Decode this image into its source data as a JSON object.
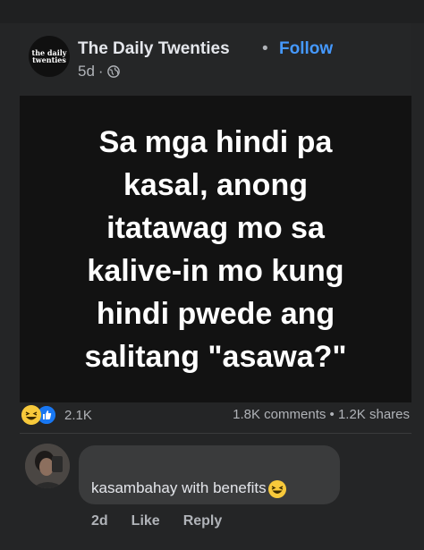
{
  "post": {
    "page_name": "The Daily Twenties",
    "separator": "•",
    "follow_label": "Follow",
    "time": "5d",
    "meta_separator": "·",
    "logo_text_line1": "the daily",
    "logo_text_line2": "twenties",
    "image_text": "Sa mga hindi pa\nkasal, anong\nitatawag mo sa\nkalive-in mo kung\nhindi pwede ang\nsalitang \"asawa?\""
  },
  "stats": {
    "reaction_count": "2.1K",
    "comments_shares": "1.8K comments • 1.2K shares",
    "reaction_icons": [
      "haha-icon",
      "like-icon"
    ]
  },
  "comment": {
    "text": "kasambahay with benefits",
    "emoji": "grinning-squinting-face-icon",
    "time": "2d",
    "like_label": "Like",
    "reply_label": "Reply"
  },
  "colors": {
    "background": "#242526",
    "image_background": "#121212",
    "follow": "#4599ff",
    "secondary_text": "#b0b3b8",
    "bubble": "#3a3b3c"
  }
}
